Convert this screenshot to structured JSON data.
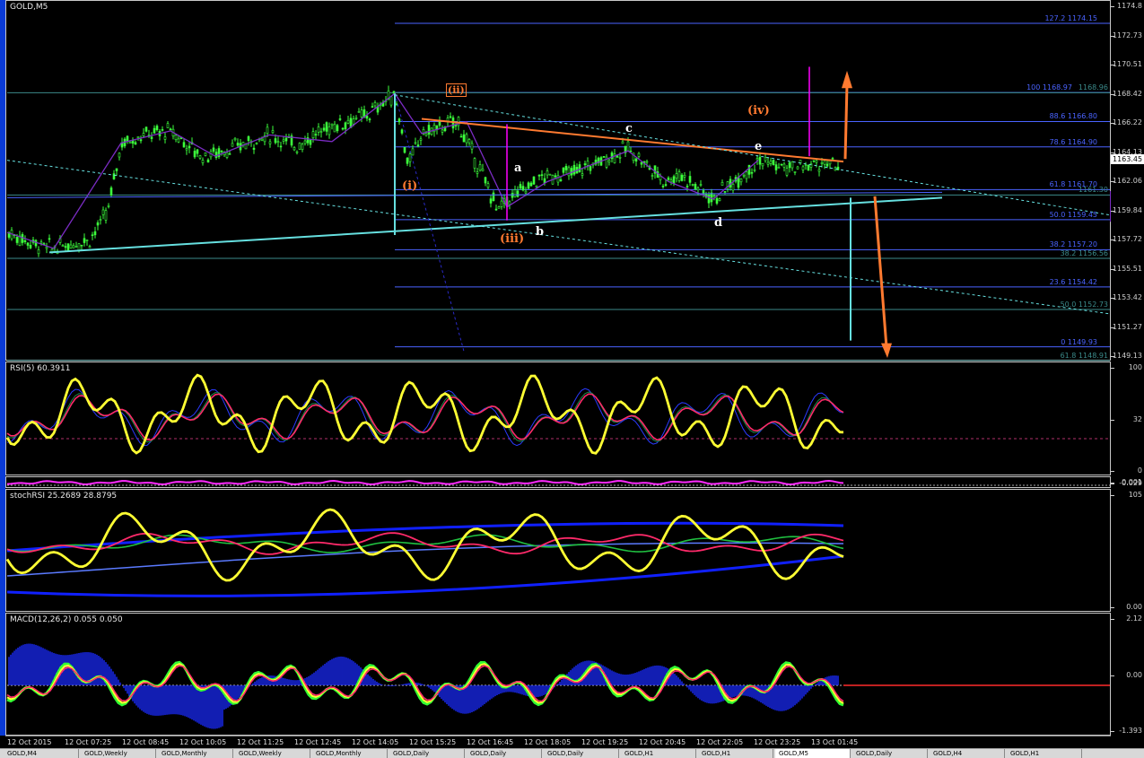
{
  "window": {
    "symbol_label": "GOLD,M5"
  },
  "colors": {
    "background": "#000000",
    "candle": "#3cff3c",
    "fib": "#4a63ff",
    "trend_cyan": "#66e0e0",
    "orange": "#ff7a30",
    "magenta": "#ff00ff",
    "rsi_yellow": "#ffff33",
    "blue_band": "#1020ff",
    "macd_hist": "#1a2cff"
  },
  "main_pane": {
    "price_scale": [
      "1174.8",
      "1172.73",
      "1170.51",
      "1168.42",
      "1166.22",
      "1164.13",
      "1162.06",
      "1159.84",
      "1157.72",
      "1155.51",
      "1153.42",
      "1151.27",
      "1149.13"
    ],
    "current_price": "1163.45",
    "fib_levels": [
      {
        "text": "127.2  1174.15",
        "color": "#4a63ff"
      },
      {
        "text": "100  1168.97",
        "color": "#4a63ff"
      },
      {
        "text": "1168.96",
        "color": "#3b8a8a"
      },
      {
        "text": "88.6  1166.80",
        "color": "#4a63ff"
      },
      {
        "text": "78.6  1164.90",
        "color": "#4a63ff"
      },
      {
        "text": "61.8  1161.70",
        "color": "#4a63ff"
      },
      {
        "text": "1161.30",
        "color": "#3b8a8a"
      },
      {
        "text": "50.0  1159.45",
        "color": "#4a63ff"
      },
      {
        "text": "38.2  1157.20",
        "color": "#4a63ff"
      },
      {
        "text": "38.2  1156.56",
        "color": "#3b8a8a"
      },
      {
        "text": "23.6  1154.42",
        "color": "#4a63ff"
      },
      {
        "text": "50.0  1152.73",
        "color": "#3b8a8a"
      },
      {
        "text": "0  1149.93",
        "color": "#4a63ff"
      },
      {
        "text": "61.8  1148.91",
        "color": "#3b8a8a"
      }
    ],
    "wave_labels": [
      {
        "text": "(ii)",
        "color": "#ff7a30"
      },
      {
        "text": "(i)",
        "color": "#ff7a30"
      },
      {
        "text": "(iii)",
        "color": "#ff7a30"
      },
      {
        "text": "(iv)",
        "color": "#ff7a30"
      },
      {
        "text": "a",
        "color": "#ffffff"
      },
      {
        "text": "b",
        "color": "#ffffff"
      },
      {
        "text": "c",
        "color": "#ffffff"
      },
      {
        "text": "d",
        "color": "#ffffff"
      },
      {
        "text": "e",
        "color": "#ffffff"
      }
    ]
  },
  "rsi_pane": {
    "label": "RSI(5) 60.3911",
    "scale": [
      "100",
      "32",
      "0"
    ]
  },
  "small_pane": {
    "scale": [
      "0.001",
      "-0.029"
    ]
  },
  "stoch_pane": {
    "label": "stochRSI 25.2689 28.8795",
    "scale": [
      "105",
      "0.00"
    ]
  },
  "macd_pane": {
    "label": "MACD(12,26,2) 0.055 0.050",
    "scale": [
      "2.12",
      "0.00",
      "-1.393"
    ]
  },
  "time_axis": [
    "12 Oct 2015",
    "12 Oct 07:25",
    "12 Oct 08:45",
    "12 Oct 10:05",
    "12 Oct 11:25",
    "12 Oct 12:45",
    "12 Oct 14:05",
    "12 Oct 15:25",
    "12 Oct 16:45",
    "12 Oct 18:05",
    "12 Oct 19:25",
    "12 Oct 20:45",
    "12 Oct 22:05",
    "12 Oct 23:25",
    "13 Oct 01:45"
  ],
  "tabs": [
    "GOLD,M4",
    "GOLD,Weekly",
    "GOLD,Monthly",
    "GOLD,Weekly",
    "GOLD,Monthly",
    "GOLD,Daily",
    "GOLD,Daily",
    "GOLD,Daily",
    "GOLD,H1",
    "GOLD,H1",
    "GOLD,M5",
    "GOLD,Daily",
    "GOLD,H4",
    "GOLD,H1"
  ],
  "chart_data": {
    "type": "line",
    "title": "GOLD,M5",
    "x": [
      "12 Oct 2015",
      "12 Oct 07:25",
      "12 Oct 08:45",
      "12 Oct 10:05",
      "12 Oct 11:25",
      "12 Oct 12:45",
      "12 Oct 14:05",
      "12 Oct 15:25",
      "12 Oct 16:45",
      "12 Oct 18:05",
      "12 Oct 19:25",
      "12 Oct 20:45",
      "12 Oct 22:05",
      "12 Oct 23:25",
      "13 Oct 01:45"
    ],
    "series": [
      {
        "name": "GOLD,M5",
        "values": [
          1158.5,
          1157.3,
          1165.2,
          1166.1,
          1164.7,
          1165.0,
          1168.9,
          1165.9,
          1160.9,
          1162.5,
          1164.8,
          1162.4,
          1161.0,
          1163.9,
          1163.45
        ]
      }
    ],
    "ylim": [
      1148.9,
      1175.9
    ]
  }
}
